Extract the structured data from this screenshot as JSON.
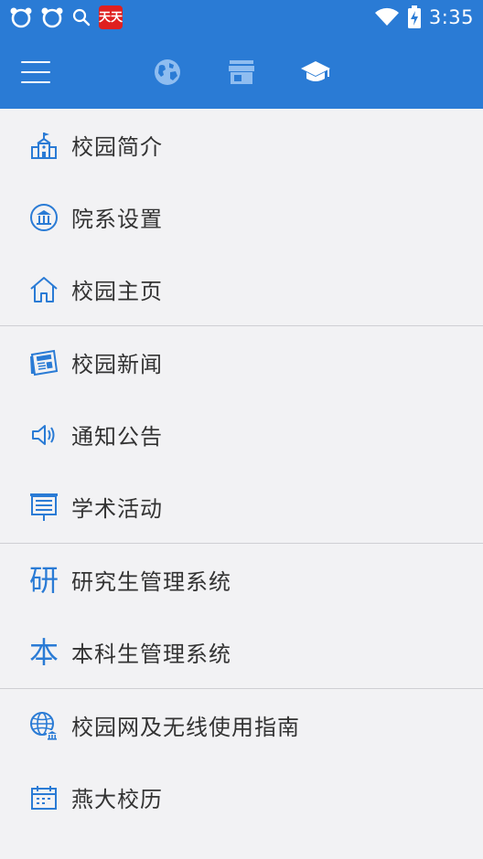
{
  "status_bar": {
    "time": "3:35",
    "app_badge_text": "天天"
  },
  "app_bar": {
    "tabs": [
      "globe-icon",
      "store-icon",
      "school-icon"
    ]
  },
  "menu": {
    "groups": [
      {
        "items": [
          {
            "label": "校园简介",
            "icon": "campus-building-icon"
          },
          {
            "label": "院系设置",
            "icon": "institution-icon"
          },
          {
            "label": "校园主页",
            "icon": "home-icon"
          }
        ]
      },
      {
        "items": [
          {
            "label": "校园新闻",
            "icon": "newspaper-icon"
          },
          {
            "label": "通知公告",
            "icon": "speaker-icon"
          },
          {
            "label": "学术活动",
            "icon": "presentation-icon"
          }
        ]
      },
      {
        "items": [
          {
            "label": "研究生管理系统",
            "icon_char": "研"
          },
          {
            "label": "本科生管理系统",
            "icon_char": "本"
          }
        ]
      },
      {
        "items": [
          {
            "label": "校园网及无线使用指南",
            "icon": "network-globe-icon"
          },
          {
            "label": "燕大校历",
            "icon": "calendar-icon"
          }
        ]
      }
    ]
  },
  "colors": {
    "primary": "#2a7bd5",
    "background": "#f2f2f4",
    "text": "#333333",
    "divider": "#cfcfd3"
  }
}
